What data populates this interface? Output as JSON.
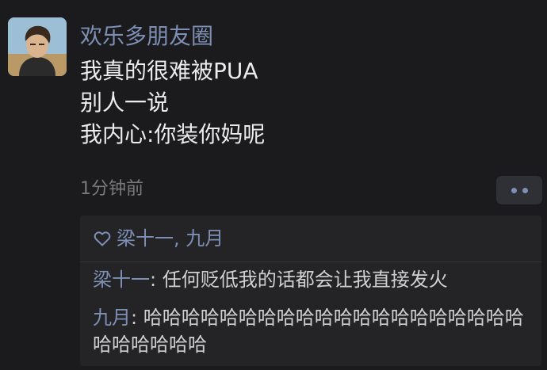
{
  "post": {
    "avatar_icon": "person-avatar",
    "username": "欢乐多朋友圈",
    "lines": [
      "我真的很难被PUA",
      "别人一说",
      "我内心:你装你妈呢"
    ],
    "timestamp": "1分钟前",
    "more_icon": "two-dots-icon"
  },
  "likes": {
    "icon": "heart-outline-icon",
    "names": "梁十一, 九月"
  },
  "comments": [
    {
      "author": "梁十一",
      "sep": ": ",
      "text": "任何贬低我的话都会让我直接发火"
    },
    {
      "author": "九月",
      "sep": ": ",
      "text": "哈哈哈哈哈哈哈哈哈哈哈哈哈哈哈哈哈哈哈哈哈哈哈哈哈哈"
    }
  ],
  "colors": {
    "background": "#1b1b1d",
    "name_accent": "#7d8fb4",
    "text": "#ececed",
    "muted": "#7a7a7d",
    "panel": "#242427"
  }
}
